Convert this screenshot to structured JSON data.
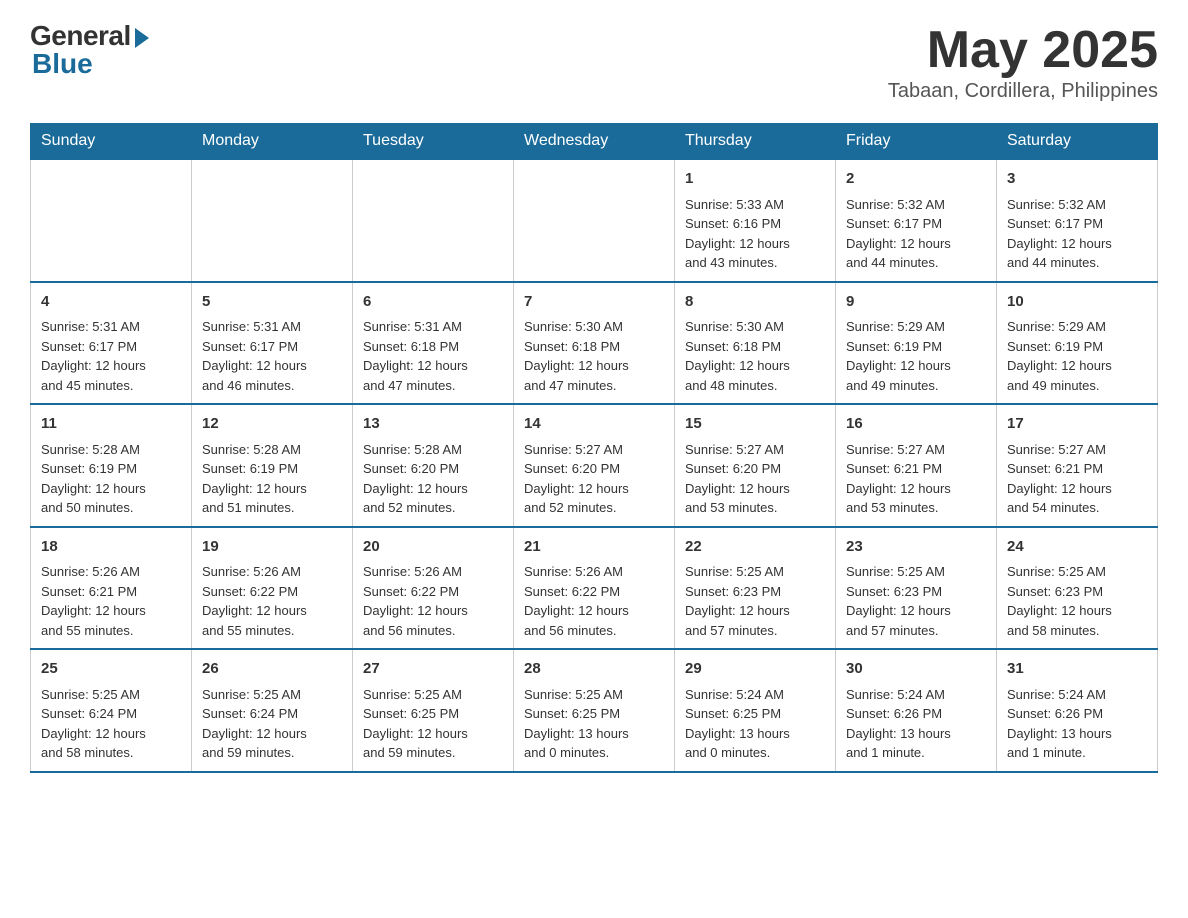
{
  "header": {
    "logo_general": "General",
    "logo_blue": "Blue",
    "month_title": "May 2025",
    "location": "Tabaan, Cordillera, Philippines"
  },
  "days_of_week": [
    "Sunday",
    "Monday",
    "Tuesday",
    "Wednesday",
    "Thursday",
    "Friday",
    "Saturday"
  ],
  "weeks": [
    [
      {
        "day": "",
        "info": ""
      },
      {
        "day": "",
        "info": ""
      },
      {
        "day": "",
        "info": ""
      },
      {
        "day": "",
        "info": ""
      },
      {
        "day": "1",
        "info": "Sunrise: 5:33 AM\nSunset: 6:16 PM\nDaylight: 12 hours\nand 43 minutes."
      },
      {
        "day": "2",
        "info": "Sunrise: 5:32 AM\nSunset: 6:17 PM\nDaylight: 12 hours\nand 44 minutes."
      },
      {
        "day": "3",
        "info": "Sunrise: 5:32 AM\nSunset: 6:17 PM\nDaylight: 12 hours\nand 44 minutes."
      }
    ],
    [
      {
        "day": "4",
        "info": "Sunrise: 5:31 AM\nSunset: 6:17 PM\nDaylight: 12 hours\nand 45 minutes."
      },
      {
        "day": "5",
        "info": "Sunrise: 5:31 AM\nSunset: 6:17 PM\nDaylight: 12 hours\nand 46 minutes."
      },
      {
        "day": "6",
        "info": "Sunrise: 5:31 AM\nSunset: 6:18 PM\nDaylight: 12 hours\nand 47 minutes."
      },
      {
        "day": "7",
        "info": "Sunrise: 5:30 AM\nSunset: 6:18 PM\nDaylight: 12 hours\nand 47 minutes."
      },
      {
        "day": "8",
        "info": "Sunrise: 5:30 AM\nSunset: 6:18 PM\nDaylight: 12 hours\nand 48 minutes."
      },
      {
        "day": "9",
        "info": "Sunrise: 5:29 AM\nSunset: 6:19 PM\nDaylight: 12 hours\nand 49 minutes."
      },
      {
        "day": "10",
        "info": "Sunrise: 5:29 AM\nSunset: 6:19 PM\nDaylight: 12 hours\nand 49 minutes."
      }
    ],
    [
      {
        "day": "11",
        "info": "Sunrise: 5:28 AM\nSunset: 6:19 PM\nDaylight: 12 hours\nand 50 minutes."
      },
      {
        "day": "12",
        "info": "Sunrise: 5:28 AM\nSunset: 6:19 PM\nDaylight: 12 hours\nand 51 minutes."
      },
      {
        "day": "13",
        "info": "Sunrise: 5:28 AM\nSunset: 6:20 PM\nDaylight: 12 hours\nand 52 minutes."
      },
      {
        "day": "14",
        "info": "Sunrise: 5:27 AM\nSunset: 6:20 PM\nDaylight: 12 hours\nand 52 minutes."
      },
      {
        "day": "15",
        "info": "Sunrise: 5:27 AM\nSunset: 6:20 PM\nDaylight: 12 hours\nand 53 minutes."
      },
      {
        "day": "16",
        "info": "Sunrise: 5:27 AM\nSunset: 6:21 PM\nDaylight: 12 hours\nand 53 minutes."
      },
      {
        "day": "17",
        "info": "Sunrise: 5:27 AM\nSunset: 6:21 PM\nDaylight: 12 hours\nand 54 minutes."
      }
    ],
    [
      {
        "day": "18",
        "info": "Sunrise: 5:26 AM\nSunset: 6:21 PM\nDaylight: 12 hours\nand 55 minutes."
      },
      {
        "day": "19",
        "info": "Sunrise: 5:26 AM\nSunset: 6:22 PM\nDaylight: 12 hours\nand 55 minutes."
      },
      {
        "day": "20",
        "info": "Sunrise: 5:26 AM\nSunset: 6:22 PM\nDaylight: 12 hours\nand 56 minutes."
      },
      {
        "day": "21",
        "info": "Sunrise: 5:26 AM\nSunset: 6:22 PM\nDaylight: 12 hours\nand 56 minutes."
      },
      {
        "day": "22",
        "info": "Sunrise: 5:25 AM\nSunset: 6:23 PM\nDaylight: 12 hours\nand 57 minutes."
      },
      {
        "day": "23",
        "info": "Sunrise: 5:25 AM\nSunset: 6:23 PM\nDaylight: 12 hours\nand 57 minutes."
      },
      {
        "day": "24",
        "info": "Sunrise: 5:25 AM\nSunset: 6:23 PM\nDaylight: 12 hours\nand 58 minutes."
      }
    ],
    [
      {
        "day": "25",
        "info": "Sunrise: 5:25 AM\nSunset: 6:24 PM\nDaylight: 12 hours\nand 58 minutes."
      },
      {
        "day": "26",
        "info": "Sunrise: 5:25 AM\nSunset: 6:24 PM\nDaylight: 12 hours\nand 59 minutes."
      },
      {
        "day": "27",
        "info": "Sunrise: 5:25 AM\nSunset: 6:25 PM\nDaylight: 12 hours\nand 59 minutes."
      },
      {
        "day": "28",
        "info": "Sunrise: 5:25 AM\nSunset: 6:25 PM\nDaylight: 13 hours\nand 0 minutes."
      },
      {
        "day": "29",
        "info": "Sunrise: 5:24 AM\nSunset: 6:25 PM\nDaylight: 13 hours\nand 0 minutes."
      },
      {
        "day": "30",
        "info": "Sunrise: 5:24 AM\nSunset: 6:26 PM\nDaylight: 13 hours\nand 1 minute."
      },
      {
        "day": "31",
        "info": "Sunrise: 5:24 AM\nSunset: 6:26 PM\nDaylight: 13 hours\nand 1 minute."
      }
    ]
  ]
}
